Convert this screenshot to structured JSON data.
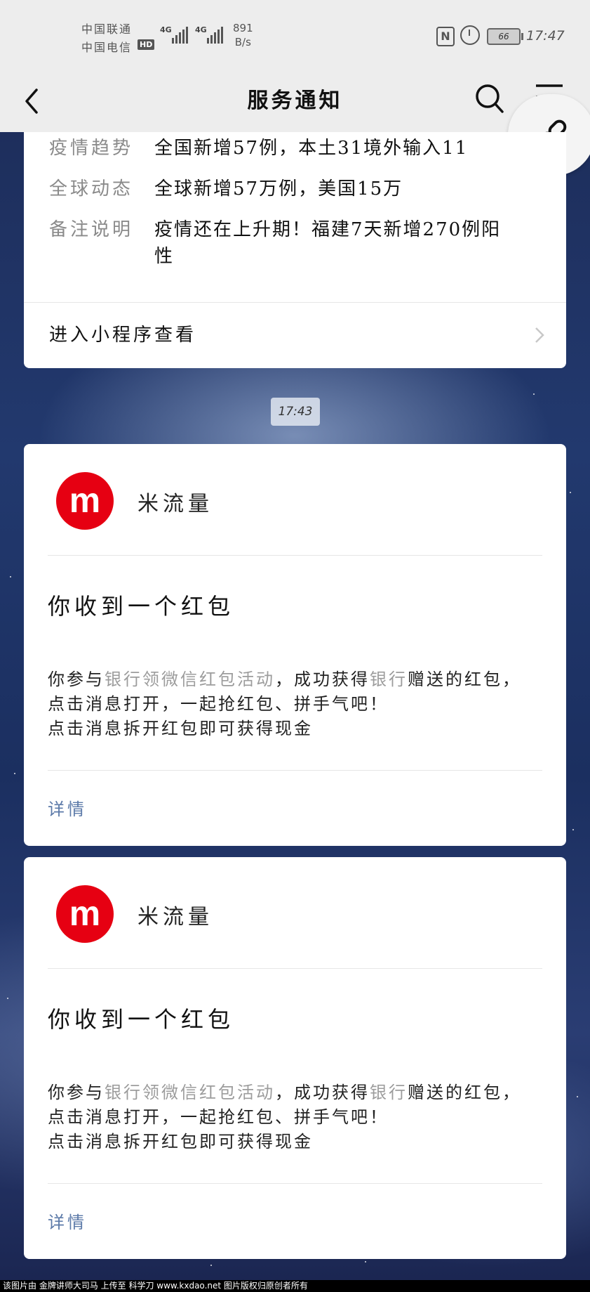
{
  "status_bar": {
    "carrier_1": "中国联通",
    "carrier_2": "中国电信",
    "hd_label": "HD",
    "signal_1": "4G",
    "signal_2": "4G",
    "net_speed_value": "891",
    "net_speed_unit": "B/s",
    "nfc_label": "N",
    "battery_level": "66",
    "time": "17:47"
  },
  "nav": {
    "title": "服务通知"
  },
  "card_top": {
    "rows": [
      {
        "label": "疫情趋势",
        "value": "全国新增57例，本土31境外输入11"
      },
      {
        "label": "全球动态",
        "value": "全球新增57万例，美国15万"
      },
      {
        "label": "备注说明",
        "value": "疫情还在上升期！福建7天新增270例阳性"
      }
    ],
    "link_label": "进入小程序查看"
  },
  "timestamp": "17:43",
  "notifications": [
    {
      "avatar_letter": "m",
      "sender": "米流量",
      "title": "你收到一个红包",
      "body_p1": "你参与",
      "body_hl1": "银行领微信红包活动",
      "body_p2": "，成功获得",
      "body_hl2": "银行",
      "body_p3": "赠送的红包，点击消息打开，一起抢红包、拼手气吧！",
      "body_line2": "点击消息拆开红包即可获得现金",
      "details_label": "详情"
    },
    {
      "avatar_letter": "m",
      "sender": "米流量",
      "title": "你收到一个红包",
      "body_p1": "你参与",
      "body_hl1": "银行领微信红包活动",
      "body_p2": "，成功获得",
      "body_hl2": "银行",
      "body_p3": "赠送的红包，点击消息打开，一起抢红包、拼手气吧！",
      "body_line2": "点击消息拆开红包即可获得现金",
      "details_label": "详情"
    }
  ],
  "footer": {
    "text": "该图片由 金牌讲师大司马 上传至 科学刀 www.kxdao.net 图片版权归原创者所有"
  },
  "colors": {
    "avatar_red": "#e60012",
    "link_blue": "#5b79a8",
    "highlight_gray": "#9c9c9c"
  }
}
